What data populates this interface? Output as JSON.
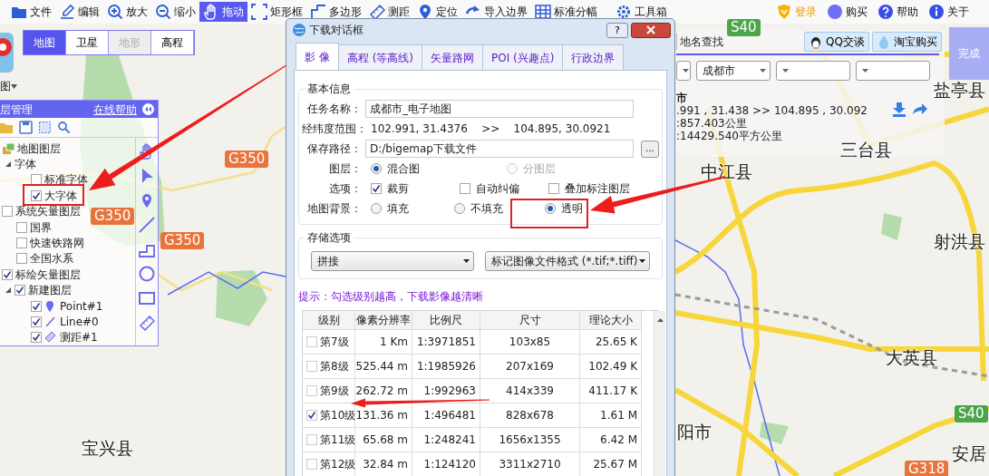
{
  "toolbar": {
    "tools": [
      {
        "label": "文件",
        "selected": false
      },
      {
        "label": "编辑",
        "selected": false
      },
      {
        "label": "放大",
        "selected": false
      },
      {
        "label": "缩小",
        "selected": false
      },
      {
        "label": "拖动",
        "selected": true
      },
      {
        "label": "矩形框",
        "selected": false
      },
      {
        "label": "多边形",
        "selected": false
      },
      {
        "label": "测距",
        "selected": false
      },
      {
        "label": "定位",
        "selected": false
      },
      {
        "label": "导入边界",
        "selected": false
      },
      {
        "label": "标准分幅",
        "selected": false
      },
      {
        "label": "工具箱",
        "selected": false
      }
    ],
    "account": [
      {
        "label": "登录",
        "highlighted": true
      },
      {
        "label": "购买",
        "highlighted": false
      },
      {
        "label": "帮助",
        "highlighted": false
      },
      {
        "label": "关于",
        "highlighted": false
      }
    ]
  },
  "map_types": [
    {
      "label": "地图",
      "selected": true,
      "disabled": false
    },
    {
      "label": "卫星",
      "selected": false,
      "disabled": false
    },
    {
      "label": "地形",
      "selected": false,
      "disabled": true
    },
    {
      "label": "高程",
      "selected": false,
      "disabled": false
    }
  ],
  "app_menu": {
    "label": "图"
  },
  "layer_panel": {
    "title": "层管理",
    "help_link": "在线帮助",
    "tree": [
      {
        "label": "地图图层",
        "kind": "group",
        "children": [
          {
            "label": "字体",
            "expanded": true,
            "children": [
              {
                "label": "标准字体",
                "checked": false
              },
              {
                "label": "大字体",
                "checked": true
              }
            ]
          }
        ]
      },
      {
        "label": "系统矢量图层",
        "checked": false,
        "children": [
          {
            "label": "国界",
            "checked": false
          },
          {
            "label": "快速铁路网",
            "checked": false
          },
          {
            "label": "全国水系",
            "checked": false
          }
        ]
      },
      {
        "label": "标绘矢量图层",
        "checked": true,
        "children": [
          {
            "label": "新建图层",
            "checked": true,
            "expanded": true,
            "children": [
              {
                "label": "Point#1",
                "kind": "point",
                "checked": true
              },
              {
                "label": "Line#0",
                "kind": "line",
                "checked": true
              },
              {
                "label": "测距#1",
                "kind": "measure",
                "checked": true
              }
            ]
          }
        ]
      }
    ]
  },
  "dialog": {
    "title": "下载对话框",
    "help_button": "?",
    "tabs": [
      {
        "label": "影 像",
        "selected": true
      },
      {
        "label": "高程 (等高线)",
        "selected": false
      },
      {
        "label": "矢量路网",
        "selected": false
      },
      {
        "label": "POI (兴趣点)",
        "selected": false
      },
      {
        "label": "行政边界",
        "selected": false
      }
    ],
    "basic_info": {
      "legend": "基本信息",
      "task_name": {
        "label": "任务名称：",
        "value": "成都市_电子地图"
      },
      "range": {
        "label": "经纬度范围：",
        "from": "102.991, 31.4376",
        "separator": ">>",
        "to": "104.895, 30.0921"
      },
      "save_path": {
        "label": "保存路径：",
        "value": "D:/bigemap下载文件",
        "browse": "..."
      },
      "layer_mode": {
        "label": "图层：",
        "options": [
          {
            "label": "混合图",
            "selected": true,
            "disabled": false
          },
          {
            "label": "分图层",
            "selected": false,
            "disabled": true
          }
        ]
      },
      "options": {
        "label": "选项：",
        "items": [
          {
            "label": "裁剪",
            "checked": true
          },
          {
            "label": "自动纠偏",
            "checked": false
          },
          {
            "label": "叠加标注图层",
            "checked": false
          }
        ]
      },
      "background": {
        "label": "地图背景：",
        "options": [
          {
            "label": "填充",
            "selected": false
          },
          {
            "label": "不填充",
            "selected": false
          },
          {
            "label": "透明",
            "selected": true
          }
        ]
      }
    },
    "storage": {
      "legend": "存储选项",
      "mode": "拼接",
      "format": "标记图像文件格式 (*.tif;*.tiff)"
    },
    "hint": "提示：勾选级别越高，下载影像越清晰",
    "levels": {
      "columns": [
        "级别",
        "像素分辨率",
        "比例尺",
        "尺寸",
        "理论大小"
      ],
      "rows": [
        {
          "checked": false,
          "level": "第7级",
          "resolution": "1 Km",
          "scale": "1:3971851",
          "size": "103x85",
          "est_size": "25.65 K"
        },
        {
          "checked": false,
          "level": "第8级",
          "resolution": "525.44 m",
          "scale": "1:1985926",
          "size": "207x169",
          "est_size": "102.49 K"
        },
        {
          "checked": false,
          "level": "第9级",
          "resolution": "262.72 m",
          "scale": "1:992963",
          "size": "414x339",
          "est_size": "411.17 K"
        },
        {
          "checked": true,
          "level": "第10级",
          "resolution": "131.36 m",
          "scale": "1:496481",
          "size": "828x678",
          "est_size": "1.61 M"
        },
        {
          "checked": false,
          "level": "第11级",
          "resolution": "65.68 m",
          "scale": "1:248241",
          "size": "1656x1355",
          "est_size": "6.42 M"
        },
        {
          "checked": false,
          "level": "第12级",
          "resolution": "32.84 m",
          "scale": "1:124120",
          "size": "3311x2710",
          "est_size": "25.67 M"
        }
      ]
    }
  },
  "search_panel": {
    "tab": "地名查找",
    "buttons": [
      {
        "label": "QQ交谈",
        "kind": "qq"
      },
      {
        "label": "淘宝购买",
        "kind": "taobao"
      }
    ],
    "selects": [
      {
        "kind": "cut"
      },
      {
        "kind": "full",
        "value": "成都市"
      },
      {
        "kind": "full"
      },
      {
        "kind": "full"
      }
    ],
    "info": {
      "name": "市",
      "range": ".991 , 31.438 >> 104.895 , 30.092",
      "perimeter": ":857.403公里",
      "area": ":14429.540平方公里"
    }
  },
  "done_button": "完成",
  "map_labels": [
    {
      "text": "盐亭县",
      "kind": "town"
    },
    {
      "text": "三台县",
      "kind": "town"
    },
    {
      "text": "中江县",
      "kind": "town"
    },
    {
      "text": "射洪县",
      "kind": "town"
    },
    {
      "text": "大英县",
      "kind": "town"
    },
    {
      "text": "阳市",
      "kind": "town"
    },
    {
      "text": "安居",
      "kind": "town"
    },
    {
      "text": "宝兴县",
      "kind": "town"
    },
    {
      "text": "G350",
      "kind": "national_road"
    },
    {
      "text": "G350",
      "kind": "national_road"
    },
    {
      "text": "G350",
      "kind": "national_road"
    },
    {
      "text": "S40",
      "kind": "provincial_road"
    },
    {
      "text": "S40",
      "kind": "provincial_road"
    },
    {
      "text": "G318",
      "kind": "national_road"
    }
  ]
}
